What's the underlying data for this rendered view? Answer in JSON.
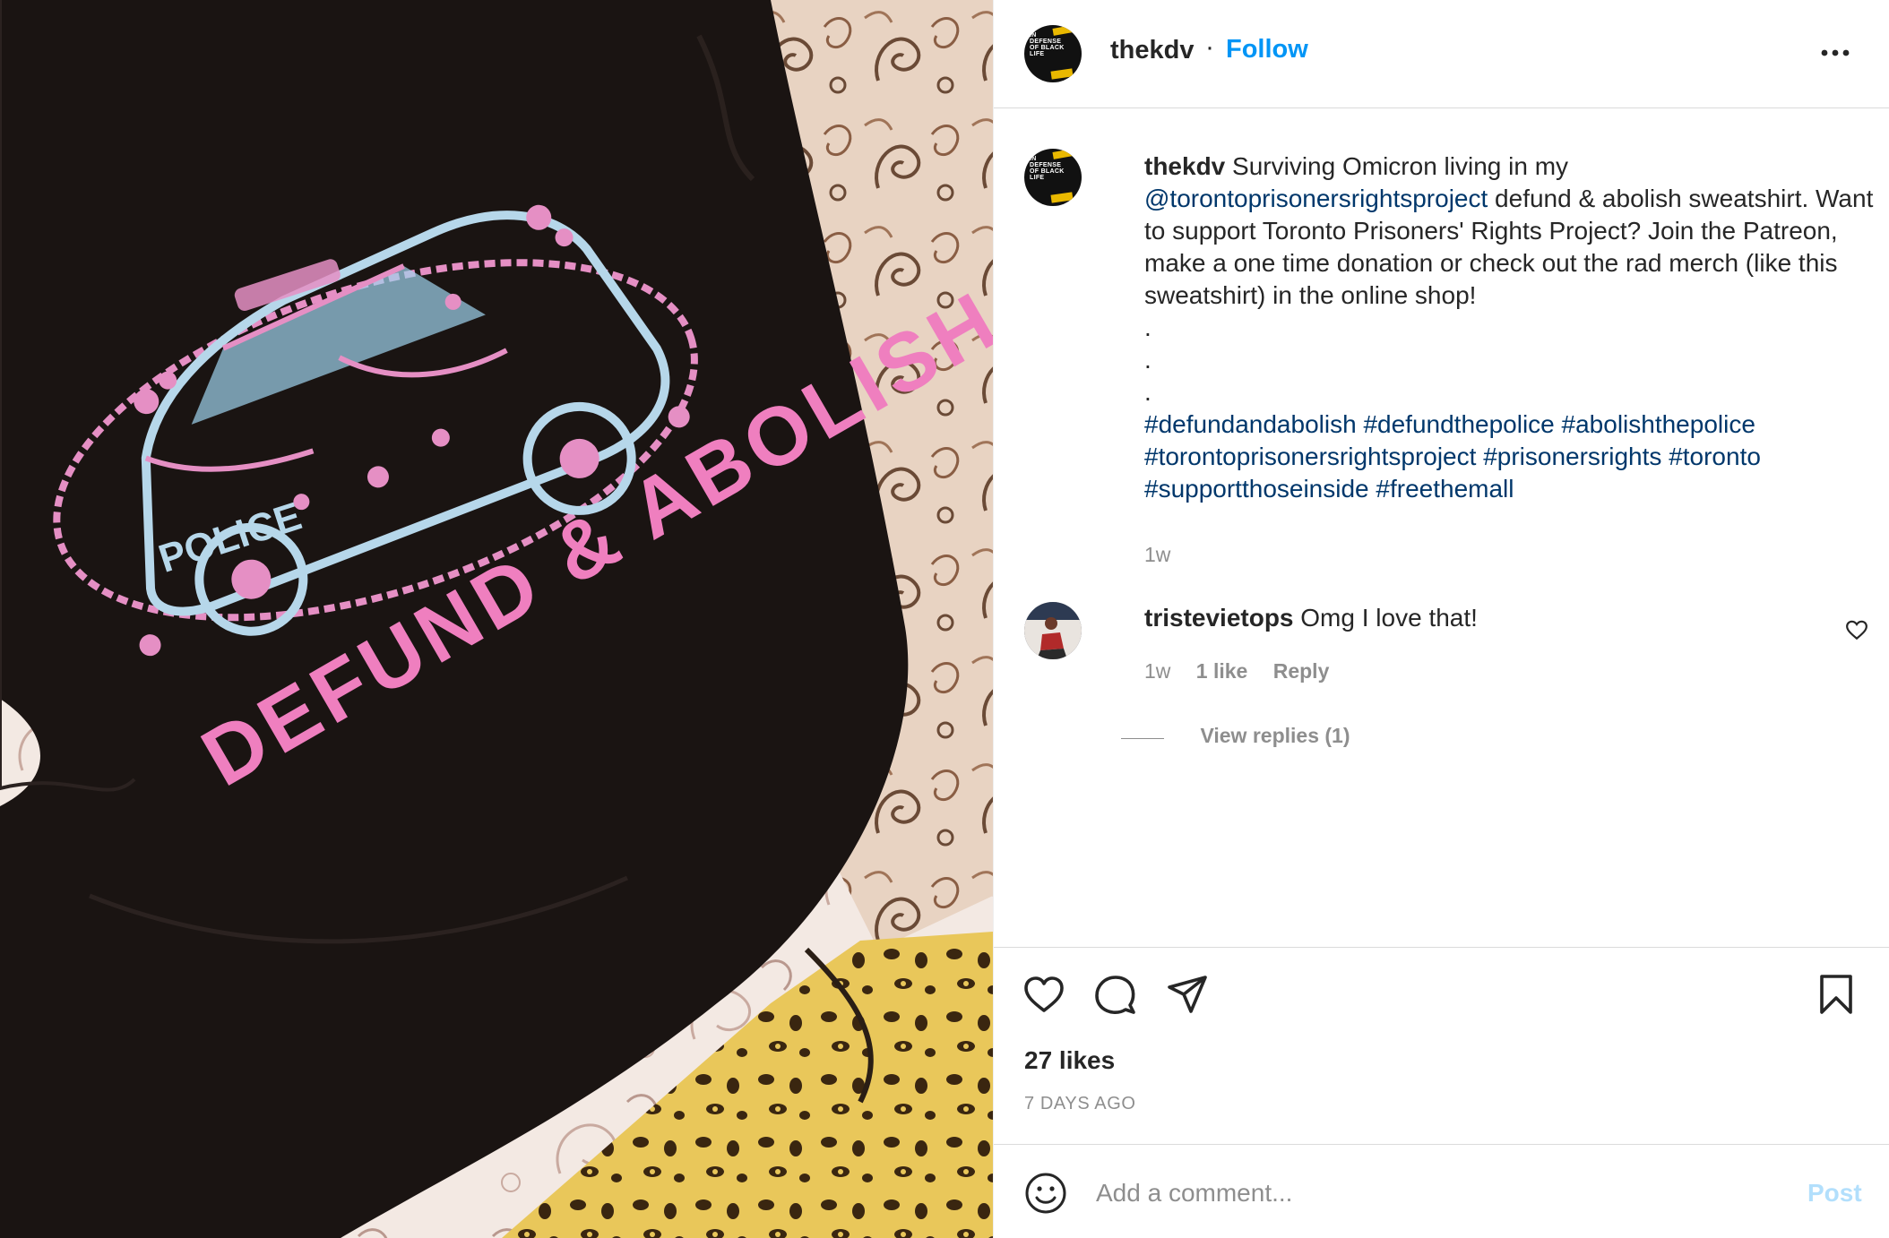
{
  "post": {
    "username": "thekdv",
    "follow_label": "Follow",
    "avatar_text": "IN DEFENSE OF BLACK LIFE"
  },
  "photo": {
    "shirt_text": "DEFUND & ABOLISH",
    "car_text": "POLICE"
  },
  "caption": {
    "username": "thekdv",
    "text_1": " Surviving Omicron living in my",
    "mention": "@torontoprisonersrightsproject",
    "text_2": " defund & abolish sweatshirt. Want to support Toronto Prisoners' Rights Project? Join the Patreon, make a one time donation or check out the rad merch (like this sweatshirt) in the online shop!",
    "dots": ".\n.\n.",
    "hashtags": [
      "#defundandabolish",
      "#defundthepolice",
      "#abolishthepolice",
      "#torontoprisonersrightsproject",
      "#prisonersrights",
      "#toronto",
      "#supportthoseinside",
      "#freethemall"
    ],
    "time": "1w"
  },
  "comment": {
    "username": "tristevietops",
    "text": " Omg I love that!",
    "time": "1w",
    "likes": "1 like",
    "reply_label": "Reply",
    "view_replies": "View replies (1)"
  },
  "actions": {
    "likes": "27 likes",
    "posted_ago": "7 DAYS AGO"
  },
  "add_comment": {
    "placeholder": "Add a comment...",
    "post_label": "Post"
  },
  "icons": {
    "like": "heart-icon",
    "comment": "speech-bubble-icon",
    "share": "paper-plane-icon",
    "save": "bookmark-icon",
    "more": "more-horizontal-icon",
    "emoji": "smiley-icon"
  },
  "colors": {
    "link": "#00376b",
    "follow": "#0095f6",
    "post_disabled": "#b2dffc",
    "muted": "#8e8e8e"
  }
}
